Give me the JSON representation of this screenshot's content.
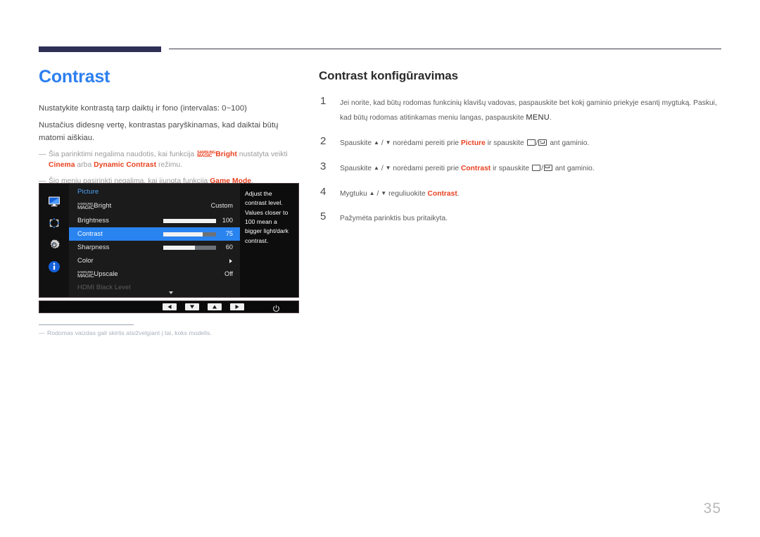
{
  "header": {
    "rule_color": "#2e3055"
  },
  "left": {
    "title": "Contrast",
    "paragraphs": [
      "Nustatykite kontrastą tarp daiktų ir fono (intervalas: 0~100)",
      "Nustačius didesnę vertę, kontrastas paryškinamas, kad daiktai būtų matomi aiškiau."
    ],
    "notes": [
      {
        "dash": "―",
        "before": "Šia parinktimi negalima naudotis, kai funkcija ",
        "logo_line1": "SAMSUNG",
        "logo_line2": "MAGIC",
        "bold1": "Bright",
        "middle": " nustatyta veikti ",
        "bold2": "Cinema",
        "middle2": " arba ",
        "bold3": "Dynamic Contrast",
        "after": " režimu."
      },
      {
        "dash": "―",
        "before": "Šio meniu pasirinkti negalima, kai įjungta funkcija ",
        "bold1": "Game Mode",
        "after": "."
      }
    ],
    "accent_color": "#e8401f",
    "title_color": "#2b7ff0"
  },
  "osd": {
    "rail_icons": [
      "monitor-icon",
      "resize-arrows-icon",
      "gear-icon",
      "info-icon"
    ],
    "menu_title": "Picture",
    "items": [
      {
        "label_logo1": "SAMSUNG",
        "label_logo2": "MAGIC",
        "label": "Bright",
        "value": "Custom",
        "slider": null,
        "selected": false,
        "dim": false,
        "arrow": false
      },
      {
        "label": "Brightness",
        "value": "100",
        "slider": 100,
        "selected": false,
        "dim": false,
        "arrow": false
      },
      {
        "label": "Contrast",
        "value": "75",
        "slider": 75,
        "selected": true,
        "dim": false,
        "arrow": false
      },
      {
        "label": "Sharpness",
        "value": "60",
        "slider": 60,
        "selected": false,
        "dim": false,
        "arrow": false
      },
      {
        "label": "Color",
        "value": "",
        "slider": null,
        "selected": false,
        "dim": false,
        "arrow": true
      },
      {
        "label_logo1": "SAMSUNG",
        "label_logo2": "MAGIC",
        "label": "Upscale",
        "value": "Off",
        "slider": null,
        "selected": false,
        "dim": false,
        "arrow": false
      },
      {
        "label": "HDMI Black Level",
        "value": "",
        "slider": null,
        "selected": false,
        "dim": true,
        "arrow": false
      }
    ],
    "description": "Adjust the contrast level. Values closer to 100 mean a bigger light/dark contrast.",
    "buttons": [
      "left-arrow-key",
      "down-arrow-key",
      "up-arrow-key",
      "right-arrow-key",
      "power-icon"
    ],
    "highlight_color": "#2a84f0",
    "footnote": {
      "dash": "―",
      "text": "Rodomas vaizdas gali skirtis atsižvelgiant į tai, koks modelis."
    }
  },
  "right": {
    "section_title": "Contrast konfigūravimas",
    "steps": [
      {
        "num": "1",
        "part1": "Jei norite, kad būtų rodomas funkcinių klavišų vadovas, paspauskite bet kokį gaminio priekyje esantį mygtuką. Paskui, kad būtų rodomas atitinkamas meniu langas, paspauskite ",
        "keyword": "MENU",
        "part2": "."
      },
      {
        "num": "2",
        "part1": "Spauskite ",
        "up": "▲",
        "sep": " / ",
        "down": "▼",
        "part2": " norėdami pereiti prie ",
        "bold": "Picture",
        "part3": " ir spauskite ",
        "part4": " ant gaminio."
      },
      {
        "num": "3",
        "part1": "Spauskite ",
        "up": "▲",
        "sep": " / ",
        "down": "▼",
        "part2": " norėdami pereiti prie ",
        "bold": "Contrast",
        "part3": " ir spauskite ",
        "part4": " ant gaminio."
      },
      {
        "num": "4",
        "part1": "Mygtuku ",
        "up": "▲",
        "sep": " / ",
        "down": "▼",
        "part2": " reguliuokite ",
        "bold": "Contrast",
        "part3": "."
      },
      {
        "num": "5",
        "part1": "Pažymėta parinktis bus pritaikyta."
      }
    ]
  },
  "footer": {
    "page_number": "35"
  }
}
